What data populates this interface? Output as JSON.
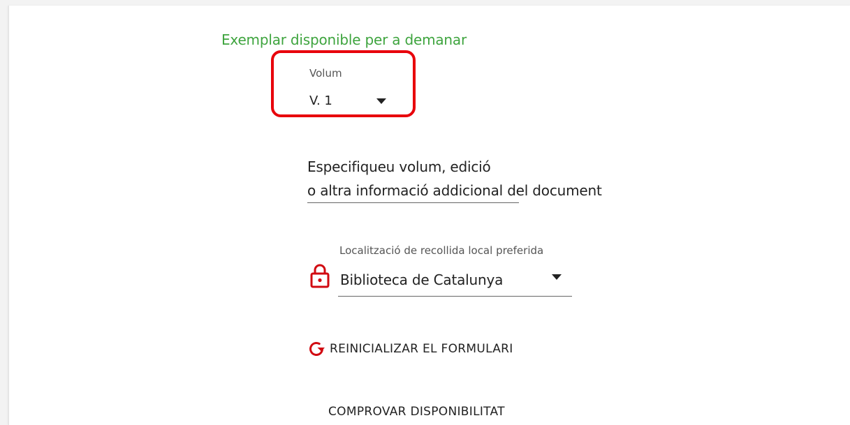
{
  "availability": {
    "status_text": "Exemplar disponible per a demanar",
    "status_color": "#3ea43e"
  },
  "volume": {
    "label": "Volum",
    "selected": "V. 1",
    "icon": "chevron-down-icon",
    "highlight_color": "#e8000b"
  },
  "specify": {
    "line1": "Especifiqueu volum, edició",
    "line2": "o altra informació addicional del document"
  },
  "pickup": {
    "label": "Localització de recollida local preferida",
    "selected": "Biblioteca de Catalunya",
    "lock_icon": "lock-icon",
    "icon_color": "#d10a11"
  },
  "actions": {
    "reset_label": "REINICIALIZAR EL FORMULARI",
    "reset_icon": "refresh-icon",
    "check_label": "COMPROVAR DISPONIBILITAT"
  }
}
